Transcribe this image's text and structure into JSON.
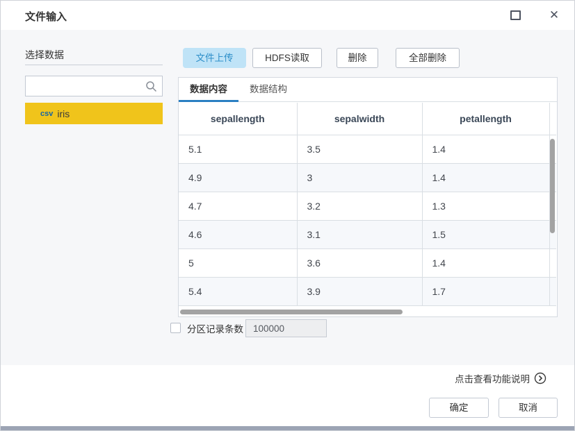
{
  "window": {
    "title": "文件输入"
  },
  "sidebar": {
    "section_label": "选择数据",
    "search_placeholder": "",
    "items": [
      {
        "badge": "csv",
        "name": "iris",
        "selected": true
      }
    ]
  },
  "toolbar": {
    "buttons": [
      {
        "label": "文件上传",
        "active": true
      },
      {
        "label": "HDFS读取",
        "active": false
      },
      {
        "label": "删除",
        "active": false
      },
      {
        "label": "全部删除",
        "active": false
      }
    ]
  },
  "tabs": [
    {
      "label": "数据内容",
      "active": true
    },
    {
      "label": "数据结构",
      "active": false
    }
  ],
  "table": {
    "columns": [
      "sepallength",
      "sepalwidth",
      "petallength"
    ],
    "rows": [
      [
        "5.1",
        "3.5",
        "1.4"
      ],
      [
        "4.9",
        "3",
        "1.4"
      ],
      [
        "4.7",
        "3.2",
        "1.3"
      ],
      [
        "4.6",
        "3.1",
        "1.5"
      ],
      [
        "5",
        "3.6",
        "1.4"
      ],
      [
        "5.4",
        "3.9",
        "1.7"
      ]
    ]
  },
  "partition": {
    "label": "分区记录条数",
    "value": "100000",
    "checked": false
  },
  "footer": {
    "help_text": "点击查看功能说明",
    "ok_label": "确定",
    "cancel_label": "取消"
  },
  "colors": {
    "accent_blue": "#2e8fc9",
    "active_tab_underline": "#2b7fc2",
    "upload_button_bg": "#bfe3f7",
    "selected_item_bg": "#f0c41b",
    "row_alt_bg": "#f6f8fb",
    "bottom_bar": "#9ca4b4"
  }
}
